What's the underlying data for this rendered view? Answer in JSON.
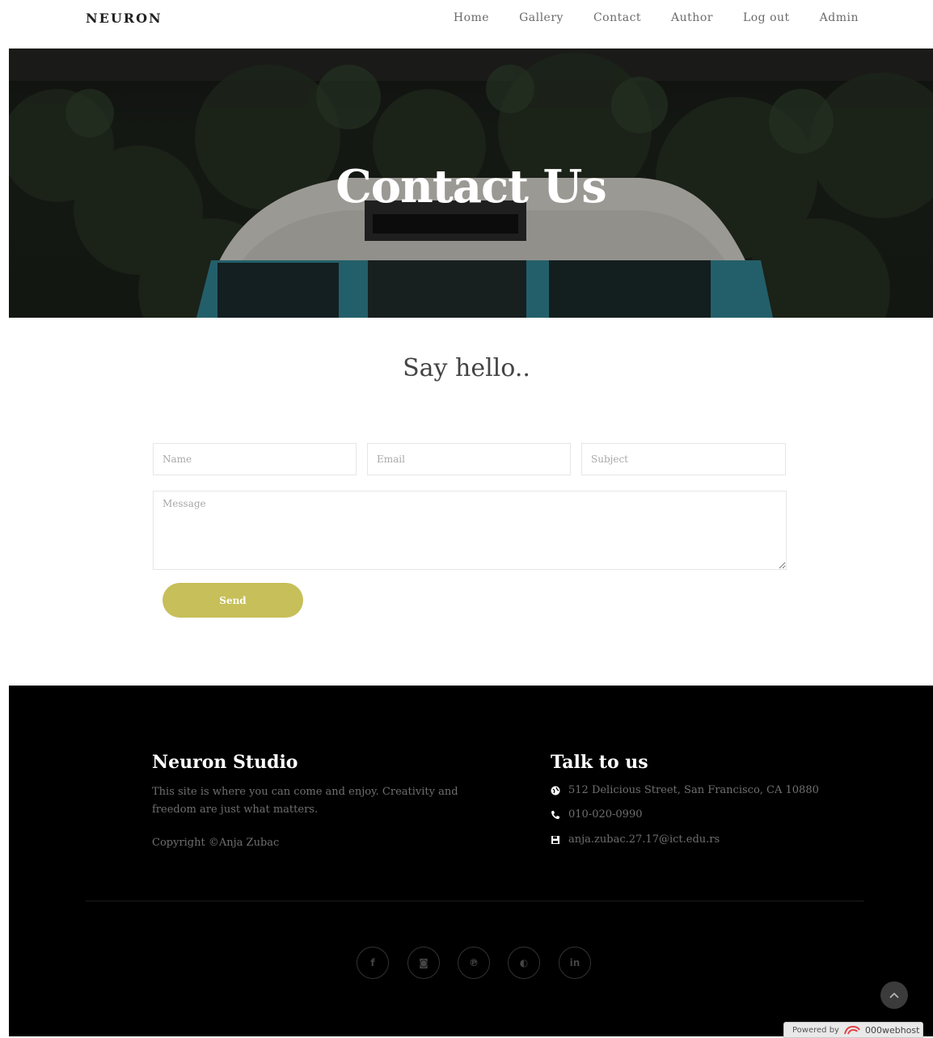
{
  "brand": "NEURON",
  "nav": [
    "Home",
    "Gallery",
    "Contact",
    "Author",
    "Log out",
    "Admin"
  ],
  "hero": {
    "title": "Contact Us"
  },
  "section": {
    "heading": "Say hello.."
  },
  "form": {
    "name_placeholder": "Name",
    "email_placeholder": "Email",
    "subject_placeholder": "Subject",
    "message_placeholder": "Message",
    "send_label": "Send"
  },
  "footer": {
    "studio_title": "Neuron Studio",
    "studio_text_line1": "This site is where you can come and enjoy. Creativity and",
    "studio_text_line2": "freedom are just what matters.",
    "copyright": "Copyright ©Anja Zubac",
    "talk_title": "Talk to us",
    "address": "512 Delicious Street, San Francisco, CA 10880",
    "phone": "010-020-0990",
    "email": "anja.zubac.27.17@ict.edu.rs",
    "social": [
      {
        "icon": "facebook-icon",
        "glyph": "f"
      },
      {
        "icon": "instagram-icon",
        "glyph": "◙"
      },
      {
        "icon": "pinterest-icon",
        "glyph": "℗"
      },
      {
        "icon": "github-icon",
        "glyph": "◐"
      },
      {
        "icon": "linkedin-icon",
        "glyph": "in"
      }
    ]
  },
  "powered_by": {
    "prefix": "Powered by",
    "brand": "000webhost"
  },
  "colors": {
    "accent": "#c7bf59",
    "footer_bg": "#000000",
    "van": "#2f7f8e"
  }
}
